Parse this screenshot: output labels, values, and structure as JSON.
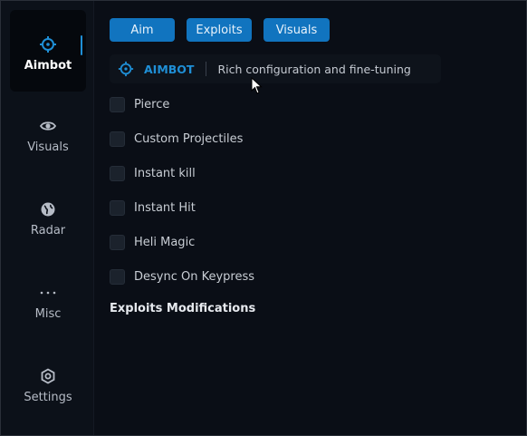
{
  "sidebar": {
    "items": [
      {
        "label": "Aimbot",
        "icon": "crosshair-icon",
        "active": true
      },
      {
        "label": "Visuals",
        "icon": "eye-icon",
        "active": false
      },
      {
        "label": "Radar",
        "icon": "globe-icon",
        "active": false
      },
      {
        "label": "Misc",
        "icon": "ellipsis-icon",
        "active": false
      },
      {
        "label": "Settings",
        "icon": "gear-icon",
        "active": false
      }
    ]
  },
  "tabs": [
    {
      "label": "Aim"
    },
    {
      "label": "Exploits"
    },
    {
      "label": "Visuals"
    }
  ],
  "header": {
    "title": "AIMBOT",
    "subtitle": "Rich configuration and fine-tuning"
  },
  "options": [
    {
      "label": "Pierce",
      "checked": false
    },
    {
      "label": "Custom Projectiles",
      "checked": false
    },
    {
      "label": "Instant kill",
      "checked": false
    },
    {
      "label": "Instant Hit",
      "checked": false
    },
    {
      "label": "Heli Magic",
      "checked": false
    },
    {
      "label": "Desync On Keypress",
      "checked": false
    }
  ],
  "section": {
    "title": "Exploits Modifications"
  },
  "colors": {
    "accent": "#1f8fd6",
    "tab_bg": "#1174bf",
    "background": "#0a0e16"
  }
}
